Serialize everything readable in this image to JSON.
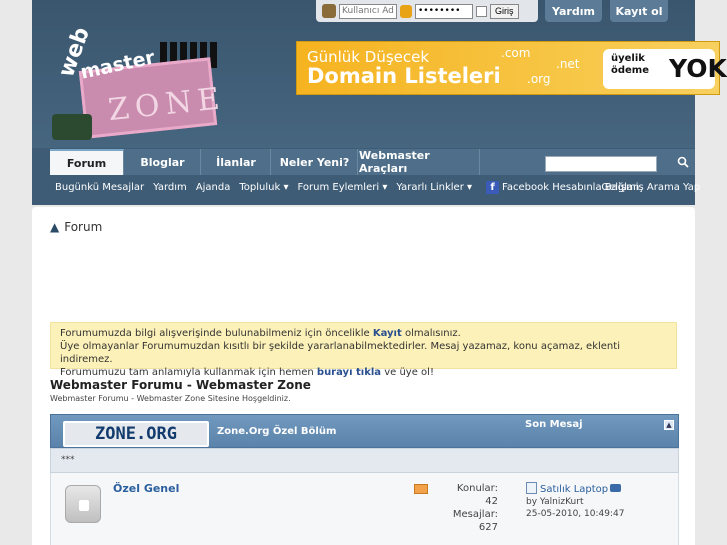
{
  "login": {
    "username_placeholder": "Kullanıcı Adı",
    "password_value": "••••••••",
    "submit_label": "Giriş"
  },
  "top_links": {
    "help": "Yardım",
    "register": "Kayıt ol"
  },
  "logo": {
    "web": "web",
    "master": "master",
    "zone": "ZONE"
  },
  "banner": {
    "line1": "Günlük Düşecek",
    "line2": "Domain Listeleri",
    "tlds": [
      ".com",
      ".net",
      ".org"
    ],
    "free_line1": "üyelik",
    "free_line2": "ödeme",
    "free_big": "YOK"
  },
  "nav": {
    "tabs": [
      "Forum",
      "Bloglar",
      "İlanlar",
      "Neler Yeni?",
      "Webmaster Araçları"
    ],
    "search_placeholder": ""
  },
  "subnav": {
    "items": [
      "Bugünkü Mesajlar",
      "Yardım",
      "Ajanda",
      "Topluluk",
      "Forum Eylemleri",
      "Yararlı Linkler",
      "Facebook Hesabınla Bağlan",
      "Gelişmiş Arama Yap"
    ],
    "dropdown_marker": "▾",
    "fb_letter": "f"
  },
  "breadcrumb": {
    "label": "Forum"
  },
  "notice": {
    "line1_pre": "Forumumuzda bilgi alışverişinde bulunabilmeniz için öncelikle ",
    "line1_link": "Kayıt",
    "line1_post": " olmalısınız.",
    "line2": "Üye olmayanlar Forumumuzdan kısıtlı bir şekilde yararlanabilmektedirler. Mesaj yazamaz, konu açamaz, eklenti indiremez.",
    "line3_pre": "Forumumuzu tam anlamıyla kullanmak için hemen ",
    "line3_link": "burayı tıkla",
    "line3_post": " ve üye ol!"
  },
  "forum_header": {
    "title": "Webmaster Forumu - Webmaster Zone",
    "subtitle": "Webmaster Forumu - Webmaster Zone Sitesine Hoşgeldiniz."
  },
  "category": {
    "logo_text": "ZONE.ORG",
    "name": "Zone.Org Özel Bölüm",
    "last_post_header": "Son Mesaj",
    "description": "***"
  },
  "forum": {
    "name": "Özel Genel",
    "threads_label": "Konular:",
    "threads_value": "42",
    "posts_label": "Mesajlar:",
    "posts_value": "627",
    "last_title": "Satılık Laptop",
    "last_by": "by YalnizKurt",
    "last_date": "25-05-2010, 10:49:47"
  }
}
